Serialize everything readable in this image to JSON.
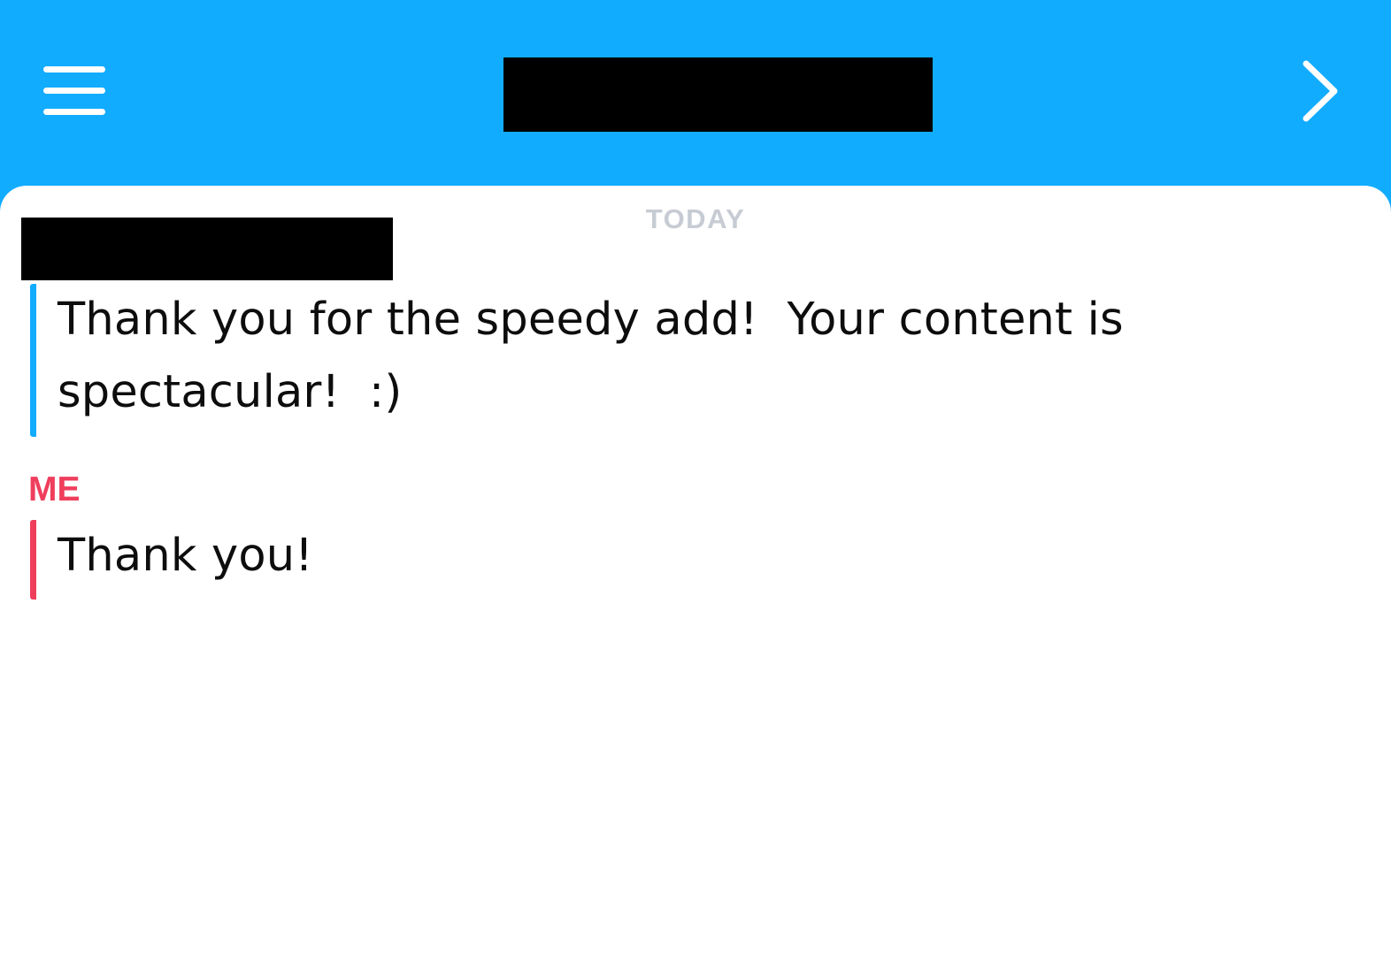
{
  "header": {
    "menu_icon": "hamburger-menu-icon",
    "forward_icon": "chevron-right-icon",
    "title_redacted": true
  },
  "chat": {
    "date_label": "TODAY",
    "messages": [
      {
        "sender_redacted": true,
        "text": "Thank you for the speedy add!  Your content is spectacular!  :)",
        "accent": "#12acff"
      },
      {
        "sender": "ME",
        "text": "Thank you!",
        "accent": "#ef3e5c"
      }
    ]
  },
  "colors": {
    "header_bg": "#12acff",
    "panel_bg": "#ffffff",
    "me_color": "#ef3e5c",
    "date_color": "#c7cbd3"
  }
}
